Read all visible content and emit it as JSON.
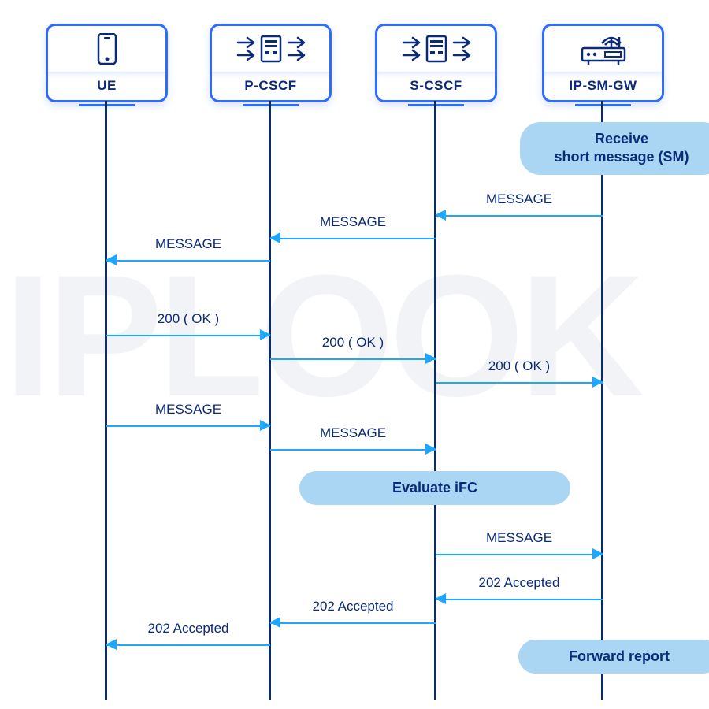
{
  "watermark": "IPLOOK",
  "participants": {
    "ue": {
      "label": "UE",
      "center": 135
    },
    "pcscf": {
      "label": "P-CSCF",
      "center": 343
    },
    "scscf": {
      "label": "S-CSCF",
      "center": 553
    },
    "ipsmgw": {
      "label": "IP-SM-GW",
      "center": 765
    }
  },
  "notes": {
    "receive": {
      "text": "Receive\nshort message (SM)"
    },
    "ifc": {
      "text": "Evaluate iFC"
    },
    "forward": {
      "text": "Forward report"
    }
  },
  "messages": {
    "m1": {
      "label": "MESSAGE"
    },
    "m2": {
      "label": "MESSAGE"
    },
    "m3": {
      "label": "MESSAGE"
    },
    "m4": {
      "label": "200 ( OK )"
    },
    "m5": {
      "label": "200 ( OK )"
    },
    "m6": {
      "label": "200 ( OK )"
    },
    "m7": {
      "label": "MESSAGE"
    },
    "m8": {
      "label": "MESSAGE"
    },
    "m9": {
      "label": "MESSAGE"
    },
    "m10": {
      "label": "202 Accepted"
    },
    "m11": {
      "label": "202 Accepted"
    },
    "m12": {
      "label": "202 Accepted"
    }
  },
  "colors": {
    "primary": "#2f6bff",
    "arrow": "#1ea7ff",
    "note": "#aad5f3",
    "text": "#0b2a78"
  }
}
